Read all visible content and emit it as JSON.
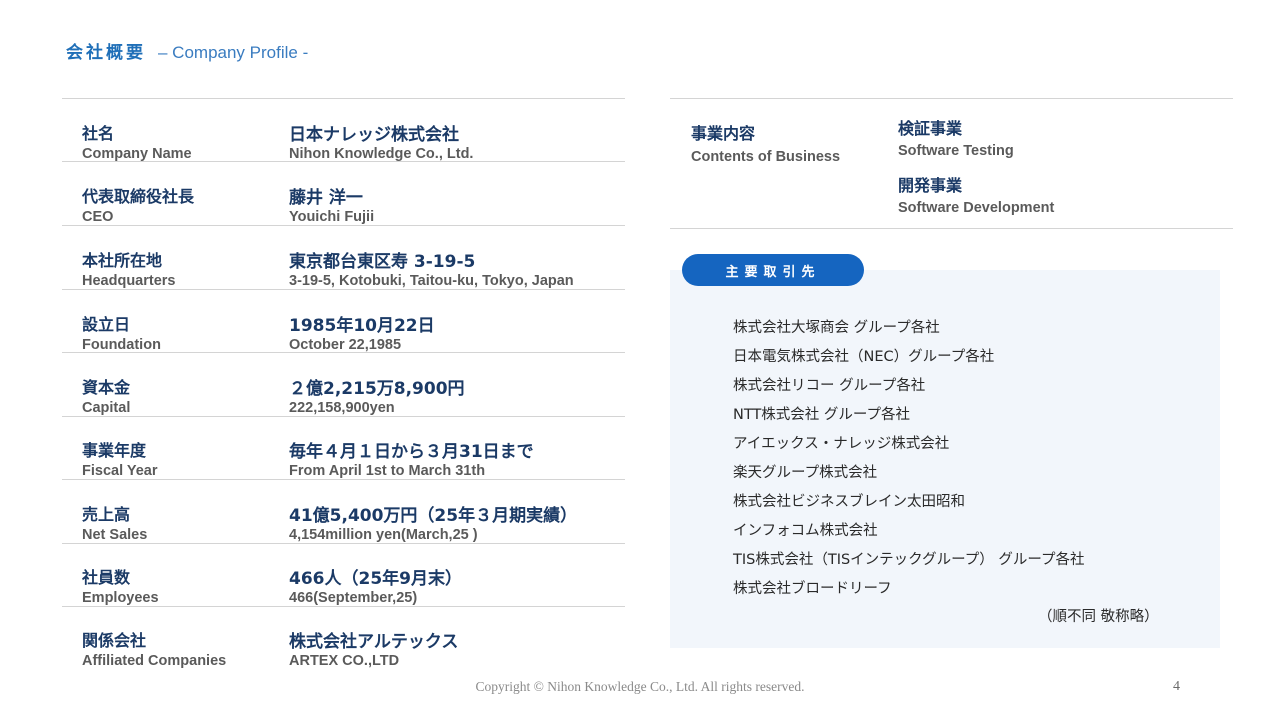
{
  "header": {
    "title_jp": "会社概要",
    "title_en": "– Company Profile -"
  },
  "profile": [
    {
      "label_jp": "社名",
      "label_en": "Company Name",
      "value_jp": "日本ナレッジ株式会社",
      "value_en": "Nihon Knowledge Co., Ltd."
    },
    {
      "label_jp": "代表取締役社長",
      "label_en": "CEO",
      "value_jp": "藤井 洋一",
      "value_en": "Youichi Fujii"
    },
    {
      "label_jp": "本社所在地",
      "label_en": "Headquarters",
      "value_jp": "東京都台東区寿 3-19-5",
      "value_en": "3-19-5, Kotobuki, Taitou-ku, Tokyo, Japan"
    },
    {
      "label_jp": "設立日",
      "label_en": "Foundation",
      "value_jp": "1985年10月22日",
      "value_en": "October 22,1985"
    },
    {
      "label_jp": "資本金",
      "label_en": "Capital",
      "value_jp": "２億2,215万8,900円",
      "value_en": "222,158,900yen"
    },
    {
      "label_jp": "事業年度",
      "label_en": "Fiscal Year",
      "value_jp": "毎年４月１日から３月31日まで",
      "value_en": "From April 1st to March 31th"
    },
    {
      "label_jp": "売上高",
      "label_en": "Net Sales",
      "value_jp": "41億5,400万円（25年３月期実績）",
      "value_en": "4,154million yen(March,25 )"
    },
    {
      "label_jp": "社員数",
      "label_en": "Employees",
      "value_jp": "466人（25年9月末）",
      "value_en": "466(September,25)"
    },
    {
      "label_jp": "関係会社",
      "label_en": "Affiliated Companies",
      "value_jp": "株式会社アルテックス",
      "value_en": "ARTEX CO.,LTD"
    }
  ],
  "business": {
    "label_jp": "事業内容",
    "label_en": "Contents of Business",
    "items": [
      {
        "jp": "検証事業",
        "en": "Software Testing"
      },
      {
        "jp": "開発事業",
        "en": "Software Development"
      }
    ]
  },
  "clients": {
    "tab_label": "主要取引先",
    "list": [
      "株式会社大塚商会 グループ各社",
      "日本電気株式会社（NEC）グループ各社",
      "株式会社リコー グループ各社",
      "NTT株式会社 グループ各社",
      "アイエックス・ナレッジ株式会社",
      "楽天グループ株式会社",
      "株式会社ビジネスブレイン太田昭和",
      "インフォコム株式会社",
      "TIS株式会社（TISインテックグループ） グループ各社",
      "株式会社ブロードリーフ"
    ],
    "note": "（順不同 敬称略）"
  },
  "footer": {
    "copyright": "Copyright © Nihon Knowledge Co., Ltd. All rights reserved.",
    "page": "4"
  }
}
